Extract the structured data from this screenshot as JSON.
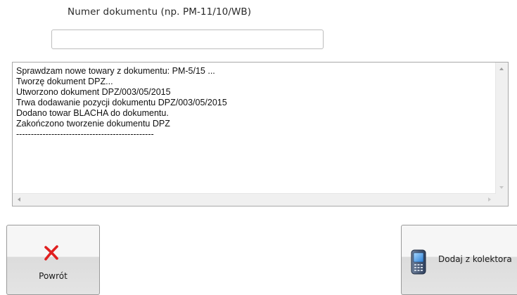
{
  "form": {
    "document_number_label": "Numer dokumentu (np. PM-11/10/WB)",
    "document_number_value": "",
    "document_number_placeholder": ""
  },
  "log": {
    "lines": [
      "Sprawdzam nowe towary z dokumentu: PM-5/15 ...",
      "Tworzę dokument DPZ...",
      "Utworzono dokument DPZ/003/05/2015",
      "Trwa dodawanie pozycji dokumentu DPZ/003/05/2015",
      "Dodano towar BLACHA do dokumentu.",
      "Zakończono tworzenie dokumentu DPZ",
      "-----------------------------------------------"
    ]
  },
  "buttons": {
    "back_label": "Powrót",
    "back_icon": "close-icon",
    "collector_label": "Dodaj z kolektora",
    "collector_icon": "handheld-device-icon"
  },
  "colors": {
    "close_icon": "#e02020",
    "border": "#a9a9a9"
  }
}
